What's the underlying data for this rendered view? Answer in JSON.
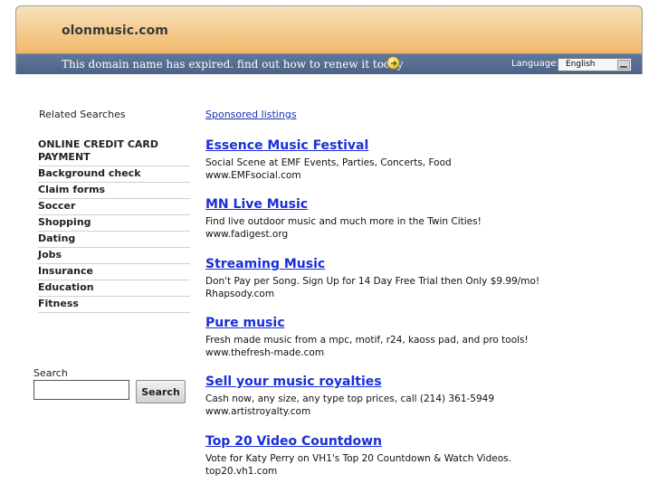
{
  "header": {
    "domain": "olonmusic.com",
    "expired_message": "This domain name has expired. find out how to renew it today",
    "language_label": "Language:",
    "language_selected": "English"
  },
  "sidebar": {
    "related_title": "Related Searches",
    "items": [
      "ONLINE CREDIT CARD PAYMENT",
      "Background check",
      "Claim forms",
      "Soccer",
      "Shopping",
      "Dating",
      "Jobs",
      "Insurance",
      "Education",
      "Fitness"
    ]
  },
  "search": {
    "label": "Search",
    "value": "",
    "button": "Search"
  },
  "main": {
    "sponsored_label": "Sponsored listings",
    "listings": [
      {
        "title": "Essence Music Festival",
        "description": "Social Scene at EMF Events, Parties, Concerts, Food",
        "url": "www.EMFsocial.com"
      },
      {
        "title": "MN Live Music",
        "description": "Find live outdoor music and much more in the Twin Cities!",
        "url": "www.fadigest.org"
      },
      {
        "title": "Streaming Music",
        "description": "Don't Pay per Song. Sign Up for 14 Day Free Trial then Only $9.99/mo!",
        "url": "Rhapsody.com"
      },
      {
        "title": "Pure music",
        "description": "Fresh made music from a mpc, motif, r24, kaoss pad, and pro tools!",
        "url": "www.thefresh-made.com"
      },
      {
        "title": "Sell your music royalties",
        "description": "Cash now, any size, any type top prices, call (214) 361-5949",
        "url": "www.artistroyalty.com"
      },
      {
        "title": "Top 20 Video Countdown",
        "description": "Vote for Katy Perry on VH1's Top 20 Countdown & Watch Videos.",
        "url": "top20.vh1.com"
      }
    ]
  }
}
